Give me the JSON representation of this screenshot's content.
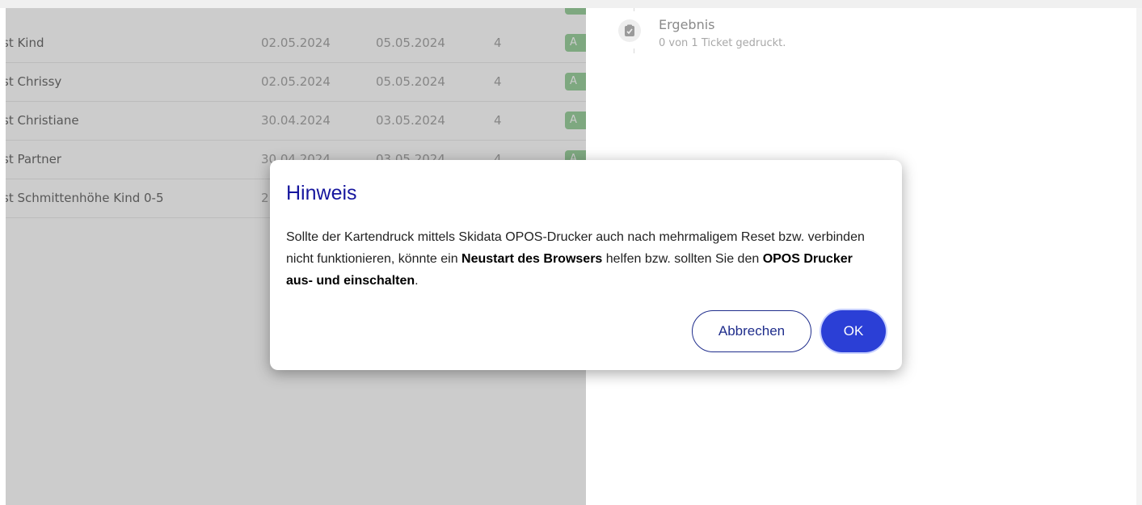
{
  "table": {
    "rows": [
      {
        "name": "st Kind",
        "from": "02.05.2024",
        "to": "05.05.2024",
        "count": "4",
        "badge": "A"
      },
      {
        "name": "st Chrissy",
        "from": "02.05.2024",
        "to": "05.05.2024",
        "count": "4",
        "badge": "A"
      },
      {
        "name": "st Christiane",
        "from": "30.04.2024",
        "to": "03.05.2024",
        "count": "4",
        "badge": "A"
      },
      {
        "name": "st Partner",
        "from": "30.04.2024",
        "to": "03.05.2024",
        "count": "4",
        "badge": "A"
      },
      {
        "name": "st Schmittenhöhe Kind 0-5",
        "from": "2",
        "to": "",
        "count": "",
        "badge": ""
      }
    ]
  },
  "result": {
    "icon": "clipboard-icon",
    "title": "Ergebnis",
    "subtitle": "0 von 1 Ticket gedruckt."
  },
  "dialog": {
    "title": "Hinweis",
    "body_part1": "Sollte der Kartendruck mittels Skidata OPOS-Drucker auch nach mehrmaligem Reset bzw. verbinden nicht funktionieren, könnte ein ",
    "body_bold1": "Neustart des Browsers",
    "body_part2": " helfen bzw. sollten Sie den ",
    "body_bold2": "OPOS Drucker aus- und einschalten",
    "body_part3": ".",
    "cancel_label": "Abbrechen",
    "ok_label": "OK"
  },
  "colors": {
    "title": "#16169e",
    "primary": "#2b3fd6",
    "badge": "#9ed3a0"
  }
}
